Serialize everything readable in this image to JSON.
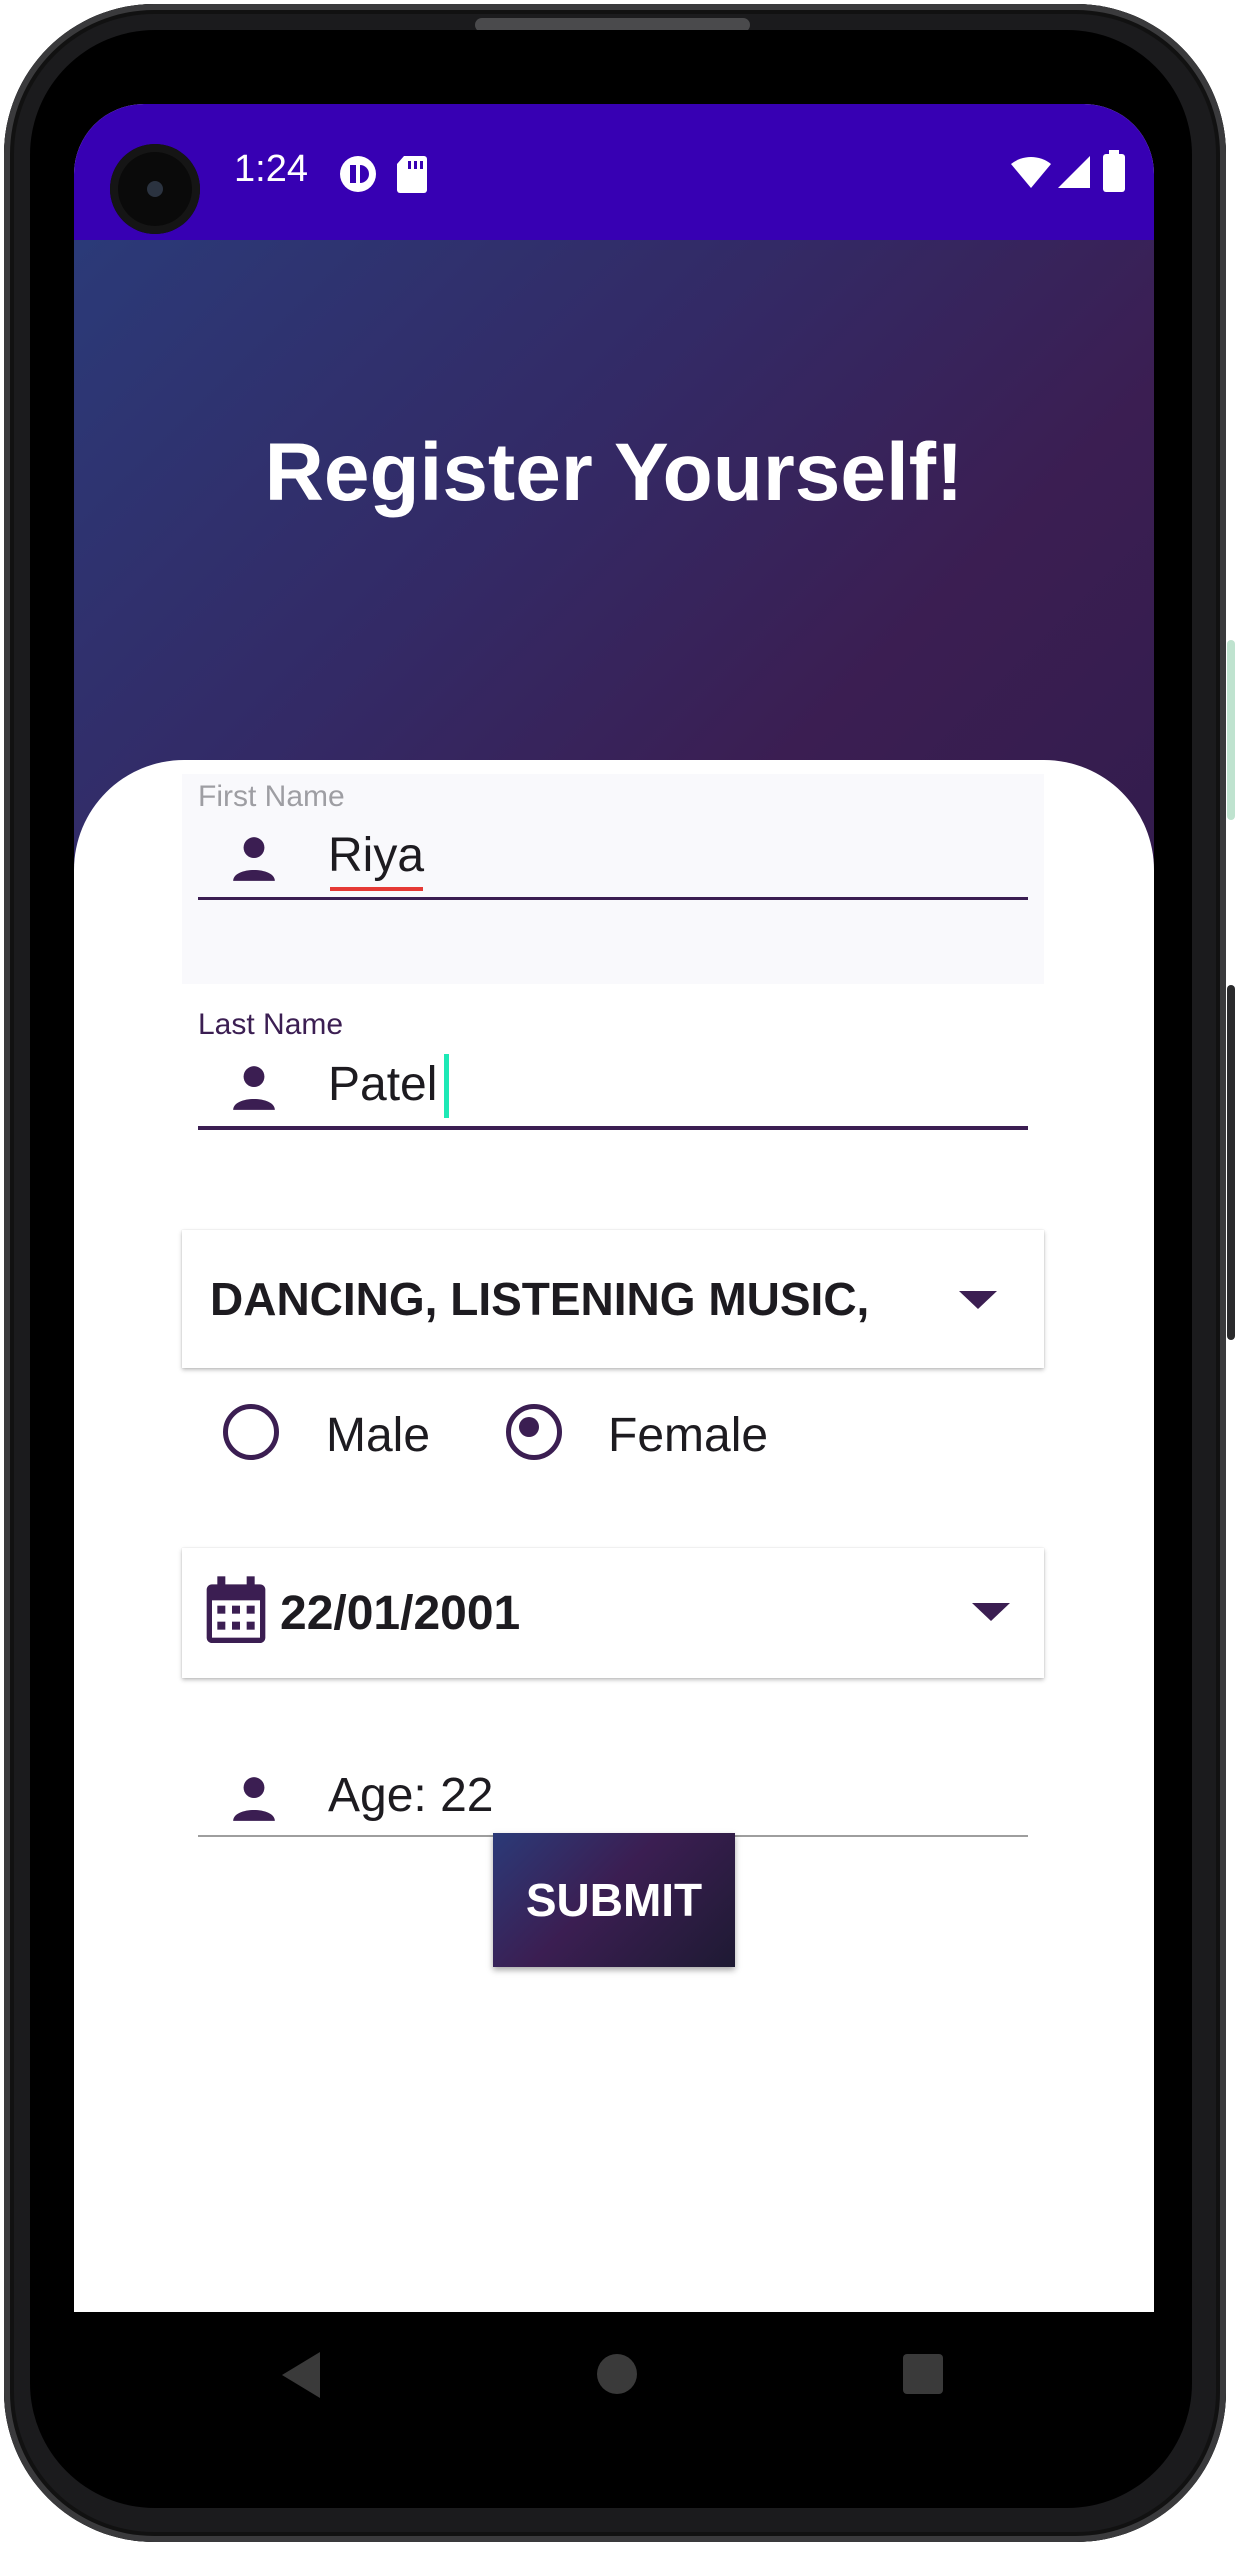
{
  "status_bar": {
    "time": "1:24",
    "background": "#3700b3",
    "icons": [
      "camera-cutout",
      "notification-icon",
      "sd-card-icon",
      "wifi-icon",
      "signal-icon",
      "battery-icon"
    ]
  },
  "header": {
    "title": "Register Yourself!",
    "gradient": [
      "#2b3a78",
      "#3b1e52"
    ]
  },
  "form": {
    "first_name": {
      "label": "First Name",
      "value": "Riya",
      "icon": "person-icon"
    },
    "last_name": {
      "label": "Last Name",
      "value": "Patel",
      "icon": "person-icon"
    },
    "hobbies": {
      "selected": "DANCING, LISTENING MUSIC,",
      "icon": "dropdown-arrow-icon"
    },
    "gender": {
      "options": [
        {
          "label": "Male",
          "checked": false
        },
        {
          "label": "Female",
          "checked": true
        }
      ]
    },
    "dob": {
      "value": "22/01/2001",
      "icon": "calendar-icon"
    },
    "age": {
      "value": "Age: 22",
      "icon": "person-icon"
    },
    "submit_label": "SUBMIT"
  },
  "nav_bar": {
    "buttons": [
      "back-icon",
      "home-icon",
      "recents-icon"
    ]
  },
  "colors": {
    "accent": "#3b1e52",
    "cursor": "#1de9b6",
    "spell_underline": "#e53935"
  }
}
